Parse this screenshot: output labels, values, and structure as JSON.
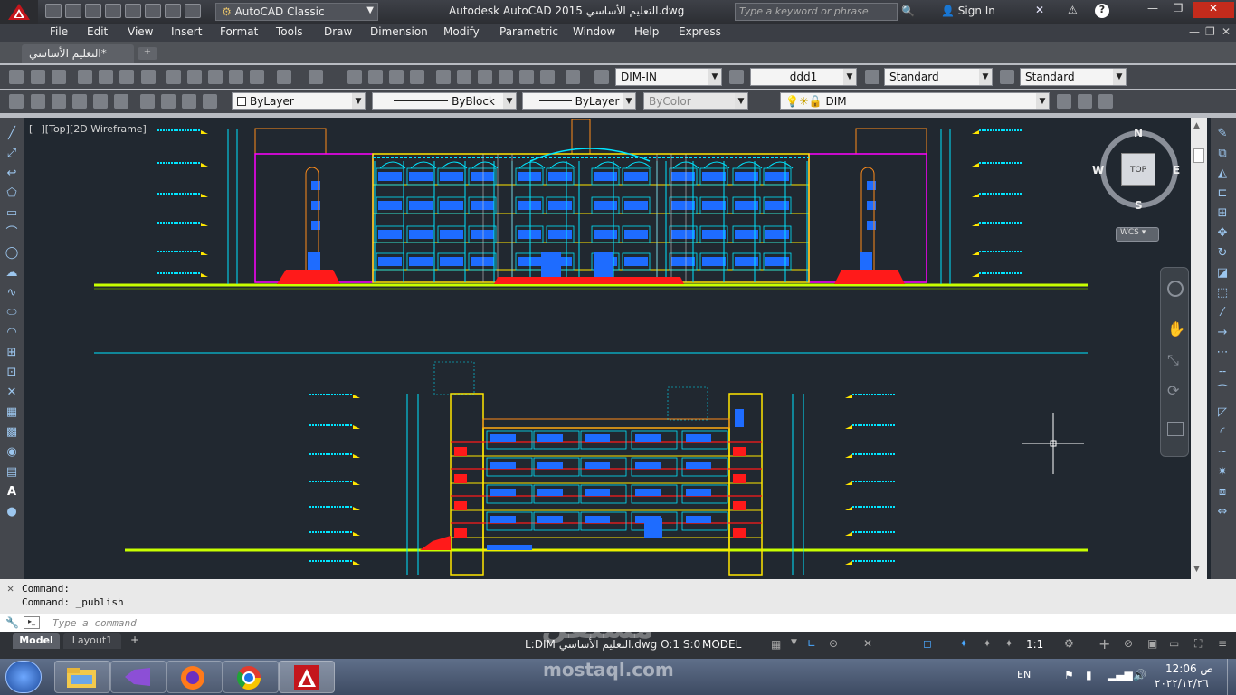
{
  "titlebar": {
    "workspace": "AutoCAD Classic",
    "title": "Autodesk AutoCAD 2015  التعليم الأساسي.dwg",
    "search_placeholder": "Type a keyword or phrase",
    "signin": "Sign In"
  },
  "menus": [
    "File",
    "Edit",
    "View",
    "Insert",
    "Format",
    "Tools",
    "Draw",
    "Dimension",
    "Modify",
    "Parametric",
    "Window",
    "Help",
    "Express"
  ],
  "tab": {
    "name": "التعليم الأساسي*",
    "new_tab": "+"
  },
  "toolbar1": {
    "dimstyle": "DIM-IN",
    "tablestyle": "ddd1",
    "textstyle": "Standard",
    "mleaderstyle": "Standard"
  },
  "toolbar2": {
    "color": "ByLayer",
    "linetype": "ByBlock",
    "lineweight": "ByLayer",
    "plotstyle": "ByColor",
    "layer": "DIM"
  },
  "viewport": {
    "label": "[−][Top][2D Wireframe]"
  },
  "viewcube": {
    "n": "N",
    "s": "S",
    "e": "E",
    "w": "W",
    "top": "TOP",
    "wcs": "WCS"
  },
  "command": {
    "history1": "Command:",
    "history2": "Command:  _publish",
    "placeholder": "Type a command"
  },
  "layouts": {
    "model": "Model",
    "layout1": "Layout1"
  },
  "status": {
    "info": "L:DIM  التعليم الأساسي.dwg O:1 S:0",
    "model": "MODEL",
    "scale": "1:1"
  },
  "taskbar": {
    "lang": "EN",
    "time": "12:06 ص",
    "date": "٢٠٢٢/١٢/٢٦"
  },
  "watermark": {
    "arabic": "مستقل",
    "latin": "mostaql.com"
  },
  "colors": {
    "canvas": "#212830",
    "ground": "#c8ff00",
    "cyan": "#00e5ff",
    "red": "#ff1a1a",
    "magenta": "#ff00ff",
    "blue": "#1e6cff",
    "yellow": "#ffe600",
    "orange": "#ff8c1a"
  }
}
